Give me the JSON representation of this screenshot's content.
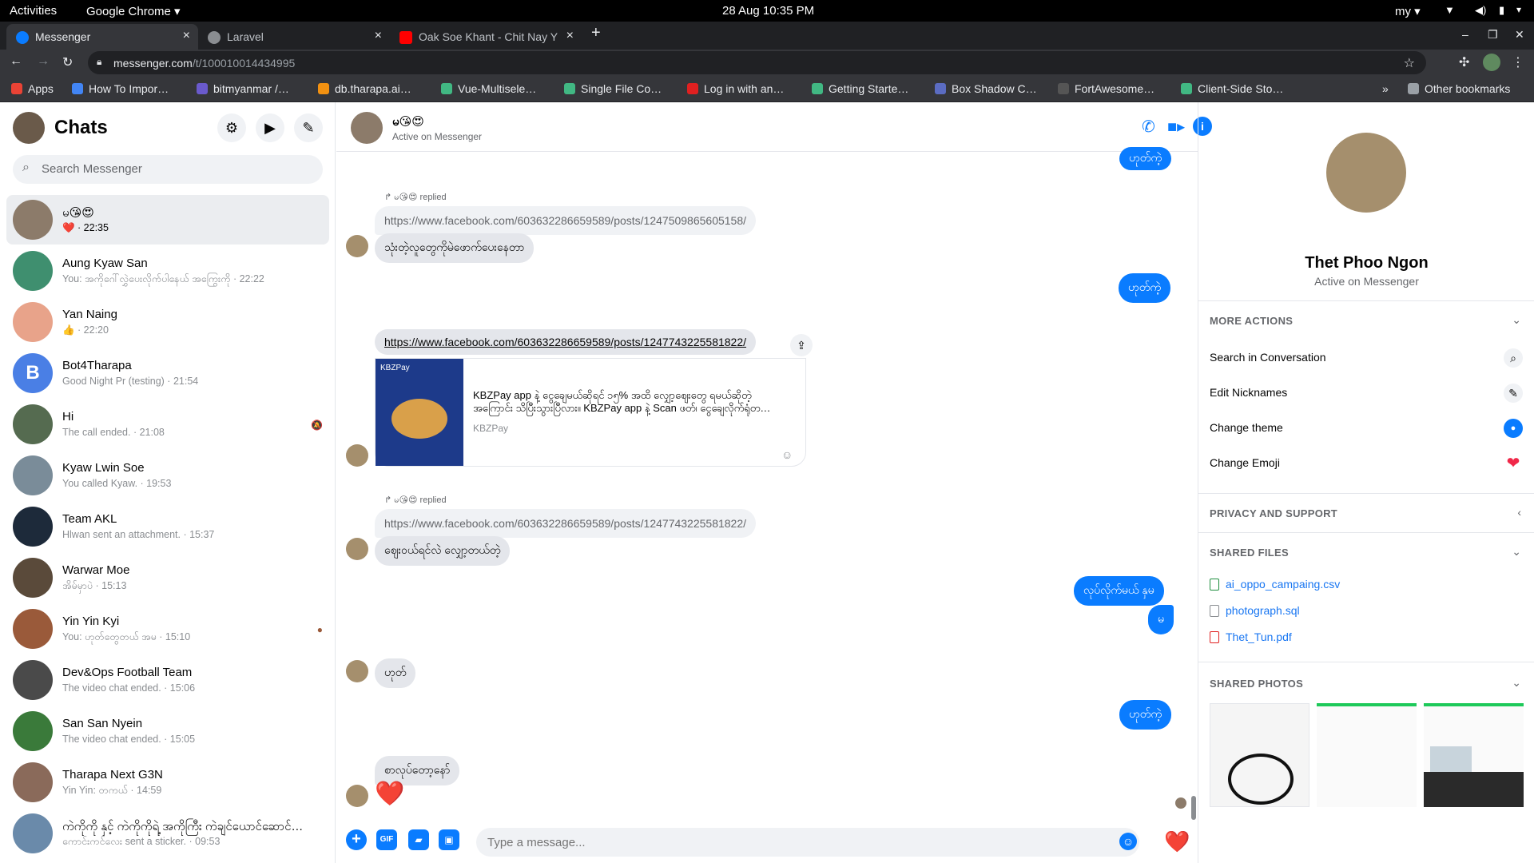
{
  "system": {
    "activities": "Activities",
    "app": "Google Chrome ▾",
    "datetime": "28 Aug  10:35 PM",
    "lang": "my ▾"
  },
  "tabs": [
    {
      "title": "Messenger",
      "color": "#0a7cff"
    },
    {
      "title": "Laravel",
      "color": "#8a8d91"
    },
    {
      "title": "Oak Soe Khant - Chit Nay Y",
      "color": "#ff0000"
    }
  ],
  "browser": {
    "url_host": "messenger.com",
    "url_path": "/t/100010014434995"
  },
  "bookmarks": [
    {
      "label": "Apps",
      "color": "#ea4335"
    },
    {
      "label": "How To Impor…",
      "color": "#4285f4"
    },
    {
      "label": "bitmyanmar /…",
      "color": "#6a5acd"
    },
    {
      "label": "db.tharapa.ai…",
      "color": "#f29111"
    },
    {
      "label": "Vue-Multisele…",
      "color": "#41b883"
    },
    {
      "label": "Single File Co…",
      "color": "#41b883"
    },
    {
      "label": "Log in with an…",
      "color": "#e02020"
    },
    {
      "label": "Getting Starte…",
      "color": "#41b883"
    },
    {
      "label": "Box Shadow C…",
      "color": "#5b6cc2"
    },
    {
      "label": "FortAwesome…",
      "color": "#555555"
    },
    {
      "label": "Client-Side Sto…",
      "color": "#41b883"
    },
    {
      "label": "»",
      "color": "#35363a"
    },
    {
      "label": "Other bookmarks",
      "color": "#9aa0a6"
    }
  ],
  "sidebar": {
    "title": "Chats",
    "search_placeholder": "Search Messenger",
    "chats": [
      {
        "name": "မ😘😍",
        "preview": "❤️ · 22:35",
        "color": "#8c7b6a",
        "extra": ""
      },
      {
        "name": "Aung Kyaw San",
        "preview": "You: အကိုဂေါ်လွှဲပေးလိုက်ပါနေယ် အကြွေးကို · 22:22",
        "color": "#3f8f6f",
        "extra": ""
      },
      {
        "name": "Yan Naing",
        "preview": "👍 · 22:20",
        "color": "#e8a38a",
        "extra": ""
      },
      {
        "name": "Bot4Tharapa",
        "preview": "Good Night Pr (testing) · 21:54",
        "color": "#4a7fe5",
        "extra": ""
      },
      {
        "name": "Hi",
        "preview": "The call ended. · 21:08",
        "color": "#556b50",
        "extra": "🔕"
      },
      {
        "name": "Kyaw Lwin Soe",
        "preview": "You called Kyaw. · 19:53",
        "color": "#7a8c99",
        "extra": ""
      },
      {
        "name": "Team AKL",
        "preview": "Hlwan sent an attachment. · 15:37",
        "color": "#1d2a3a",
        "extra": ""
      },
      {
        "name": "Warwar Moe",
        "preview": "အိမ်မှာပဲ · 15:13",
        "color": "#5a4a3a",
        "extra": ""
      },
      {
        "name": "Yin Yin Kyi",
        "preview": "You: ဟုတ်တွေတယ် အမ · 15:10",
        "color": "#9a5a3a",
        "extra": "●"
      },
      {
        "name": "Dev&Ops Football Team",
        "preview": "The video chat ended. · 15:06",
        "color": "#4a4a4a",
        "extra": ""
      },
      {
        "name": "San San Nyein",
        "preview": "The video chat ended. · 15:05",
        "color": "#3a7a3a",
        "extra": ""
      },
      {
        "name": "Tharapa Next G3N",
        "preview": "Yin Yin: တကယ် · 14:59",
        "color": "#8a6a5a",
        "extra": ""
      },
      {
        "name": "ကဲကိုကို နှင့် ကဲကိုကိုရဲ့ အကိုကြီး ကဲချင်ယောင်ဆောင်…",
        "preview": "ကောင်းကင်လေး sent a sticker. · 09:53",
        "color": "#6a8aaa",
        "extra": ""
      }
    ]
  },
  "conversation": {
    "name": "မ😘😍",
    "status": "Active on Messenger",
    "replied_label": "↱ မ😘😍 replied",
    "top_bubble": "ဟုတ်ကဲ့",
    "quote1": "https://www.facebook.com/603632286659589/posts/1247509865605158/",
    "msg1": "သုံးတဲ့လူတွေကိုမဲဖောက်ပေးနေတာ",
    "out1": "ဟုတ်ကဲ့",
    "link_url": "https://www.facebook.com/603632286659589/posts/1247743225581822/",
    "card_line1": "KBZPay app နဲ့ ငွေချေမယ်ဆိုရင် ၁၅% အထိ လျှော့ဈေးတွေ ရမယ်ဆိုတဲ့",
    "card_line2": "အကြောင်း သိပြီးသွားပြီလား။ KBZPay app နဲ့ Scan ဖတ်၊ ငွေချေလိုက်ရုံတ…",
    "card_source": "KBZPay",
    "card_image_text": "KBZPay",
    "quote2": "https://www.facebook.com/603632286659589/posts/1247743225581822/",
    "msg2": "ဈေးဝယ်ရင်လဲ လျှော့တယ်တဲ့",
    "out2": "လုပ်လိုက်မယ် နှမ",
    "out3": "မ",
    "msg3": "ဟုတ်",
    "out4": "ဟုတ်ကဲ့",
    "msg4": "စာလုပ်တော့နော်",
    "heart": "❤️",
    "input_placeholder": "Type a message..."
  },
  "composer_icons": {
    "plus": "+",
    "gif": "GIF",
    "sticker": "▰",
    "photo": "▣"
  },
  "details": {
    "name": "Thet Phoo Ngon",
    "status": "Active on Messenger",
    "more_actions": "MORE ACTIONS",
    "actions": [
      {
        "label": "Search in Conversation",
        "icon": "⌕"
      },
      {
        "label": "Edit Nicknames",
        "icon": "✎"
      },
      {
        "label": "Change theme",
        "icon": "●"
      },
      {
        "label": "Change Emoji",
        "icon": "❤"
      }
    ],
    "privacy": "PRIVACY AND SUPPORT",
    "shared_files": "SHARED FILES",
    "files": [
      "ai_oppo_campaing.csv",
      "photograph.sql",
      "Thet_Tun.pdf"
    ],
    "shared_photos": "SHARED PHOTOS"
  },
  "colors": {
    "accent": "#0a7cff",
    "heart": "#f02849"
  }
}
